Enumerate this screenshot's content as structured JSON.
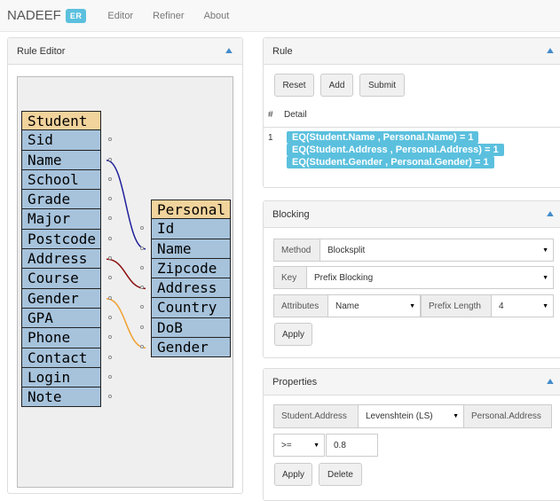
{
  "navbar": {
    "brand": "NADEEF",
    "badge": "ER",
    "links": [
      "Editor",
      "Refiner",
      "About"
    ]
  },
  "rule_editor": {
    "title": "Rule Editor",
    "student": {
      "name": "Student",
      "fields": [
        "Sid",
        "Name",
        "School",
        "Grade",
        "Major",
        "Postcode",
        "Address",
        "Course",
        "Gender",
        "GPA",
        "Phone",
        "Contact",
        "Login",
        "Note"
      ]
    },
    "personal": {
      "name": "Personal",
      "fields": [
        "Id",
        "Name",
        "Zipcode",
        "Address",
        "Country",
        "DoB",
        "Gender"
      ]
    },
    "link_colors": {
      "name": "#1f1f9a",
      "address": "#8b1010",
      "gender": "#f0a030"
    }
  },
  "rule": {
    "title": "Rule",
    "buttons": {
      "reset": "Reset",
      "add": "Add",
      "submit": "Submit"
    },
    "table": {
      "col_hash": "#",
      "col_detail": "Detail",
      "row_num": "1",
      "details": [
        "EQ(Student.Name , Personal.Name) = 1",
        "EQ(Student.Address , Personal.Address) = 1",
        "EQ(Student.Gender , Personal.Gender) = 1"
      ]
    }
  },
  "blocking": {
    "title": "Blocking",
    "method_label": "Method",
    "method_value": "Blocksplit",
    "key_label": "Key",
    "key_value": "Prefix Blocking",
    "attributes_label": "Attributes",
    "attributes_value": "Name",
    "prefix_label": "Prefix Length",
    "prefix_value": "4",
    "apply": "Apply"
  },
  "properties": {
    "title": "Properties",
    "left_attr": "Student.Address",
    "similarity": "Levenshtein (LS)",
    "right_attr": "Personal.Address",
    "operator": ">=",
    "threshold": "0.8",
    "apply": "Apply",
    "delete": "Delete"
  },
  "accent": "#5bc0de"
}
